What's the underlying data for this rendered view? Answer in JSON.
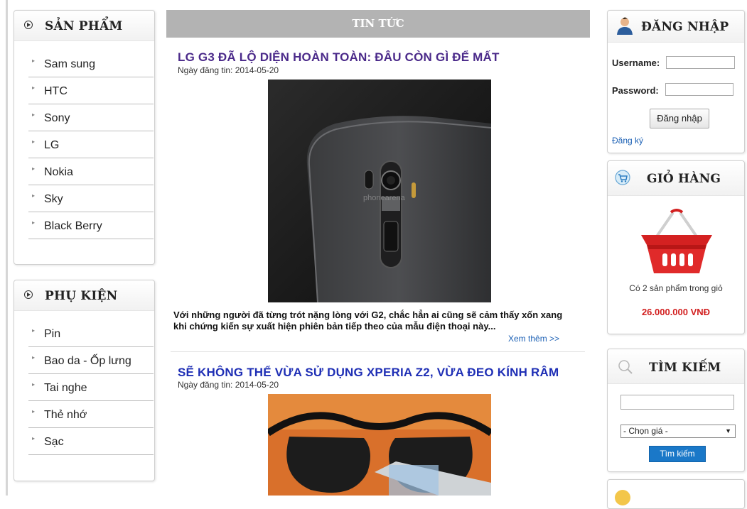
{
  "left": {
    "products": {
      "title": "SẢN PHẨM",
      "items": [
        "Sam sung",
        "HTC",
        "Sony",
        "LG",
        "Nokia",
        "Sky",
        "Black Berry"
      ]
    },
    "accessories": {
      "title": "PHỤ KIỆN",
      "items": [
        "Pin",
        "Bao da - Ốp lưng",
        "Tai nghe",
        "Thẻ nhớ",
        "Sạc"
      ]
    }
  },
  "news": {
    "header": "TIN TỨC",
    "articles": [
      {
        "title": "LG G3 ĐÃ LỘ DIỆN HOÀN TOÀN: ĐÂU CÒN GÌ ĐỂ MẤT",
        "date": "Ngày đăng tin: 2014-05-20",
        "summary": "Với những người đã từng trót nặng lòng với G2, chắc hẳn ai cũng sẽ cảm thấy xốn xang khi chứng kiến sự xuất hiện phiên bản tiếp theo của mẫu điện thoại này...",
        "more": "Xem thêm >>",
        "image_watermark": "phonearena",
        "title_color": "#4b2a8a"
      },
      {
        "title": "SẼ KHÔNG THỂ VỪA SỬ DỤNG XPERIA Z2, VỪA ĐEO KÍNH RÂM",
        "date": "Ngày đăng tin: 2014-05-20",
        "title_color": "#1f2fb5"
      }
    ]
  },
  "login": {
    "title": "ĐĂNG NHẬP",
    "username_label": "Username:",
    "password_label": "Password:",
    "button": "Đăng nhập",
    "register": "Đăng ký"
  },
  "cart": {
    "title": "GIỎ HÀNG",
    "count_text": "Có 2 sản phẩm trong giỏ",
    "total": "26.000.000 VNĐ"
  },
  "search": {
    "title": "TÌM KIẾM",
    "price_select": "- Chọn giá -",
    "button": "Tìm kiếm"
  },
  "icons": {
    "user": "user-icon",
    "cart": "cart-icon",
    "search": "magnifier-icon",
    "section": "play-circle-icon",
    "basket": "basket-icon"
  },
  "colors": {
    "news_header_bg": "#b3b3b3",
    "link": "#1a5fb4",
    "price": "#d21f1f",
    "search_button": "#1a78c8"
  }
}
